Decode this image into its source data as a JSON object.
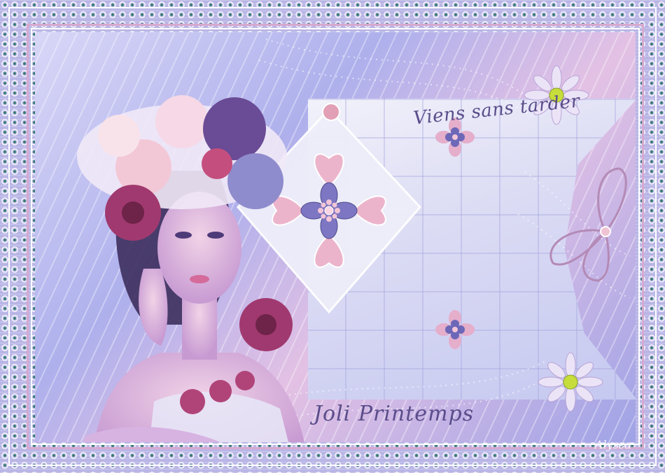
{
  "image": {
    "text_top": "Viens sans tarder",
    "text_bottom": "Joli Printemps",
    "signature": "Alyssa"
  },
  "colors": {
    "border_blue": "#b9b6e6",
    "dot_green": "#2f7a6a",
    "accent_pink": "#d7a9cf",
    "accent_purple": "#5a4d8a"
  }
}
